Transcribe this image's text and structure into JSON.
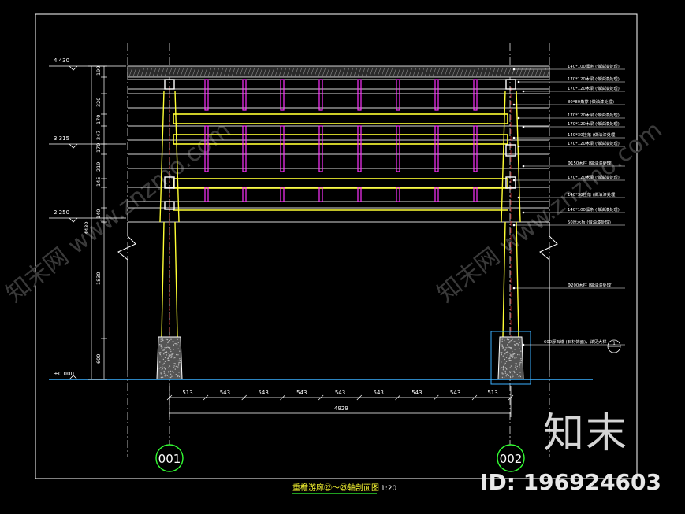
{
  "drawing": {
    "title": "重檐游廊㉒～㉓轴剖面图",
    "scale": "1:20",
    "grid_left": "001",
    "grid_right": "002",
    "elevations": [
      "4.430",
      "3.315",
      "2.250",
      "±0.000"
    ],
    "vertical_dims": [
      "199",
      "320",
      "170",
      "247",
      "170",
      "219",
      "145",
      "140",
      "1830",
      "600"
    ],
    "total_height": "4430",
    "horizontal_dims": [
      "513",
      "543",
      "543",
      "543",
      "543",
      "543",
      "543",
      "543",
      "513"
    ],
    "total_width": "4929",
    "callouts": [
      "140*100檩条 (做油漆处理)",
      "170*120木梁 (做油漆处理)",
      "170*120木梁 (做油漆处理)",
      "80*80角撑 (做油漆处理)",
      "170*120木梁 (做油漆处理)",
      "170*120木梁 (做油漆处理)",
      "140*30挂落 (做油漆处理)",
      "170*120木梁 (做油漆处理)",
      "Φ150木柱 (做油漆处理)",
      "170*120木梁 (做油漆处理)",
      "140*30挂落 (做油漆处理)",
      "140*100檩条 (做油漆处理)",
      "50厚木板 (做油漆处理)",
      "Φ200木柱 (做油漆处理)",
      "600厚石墩 (石材饰面)，详见大样"
    ],
    "detail_ref": "1"
  },
  "watermark": {
    "brand": "知末",
    "id_text": "ID: 196924603",
    "diag_text": "知末网 www.znzmo.com"
  }
}
